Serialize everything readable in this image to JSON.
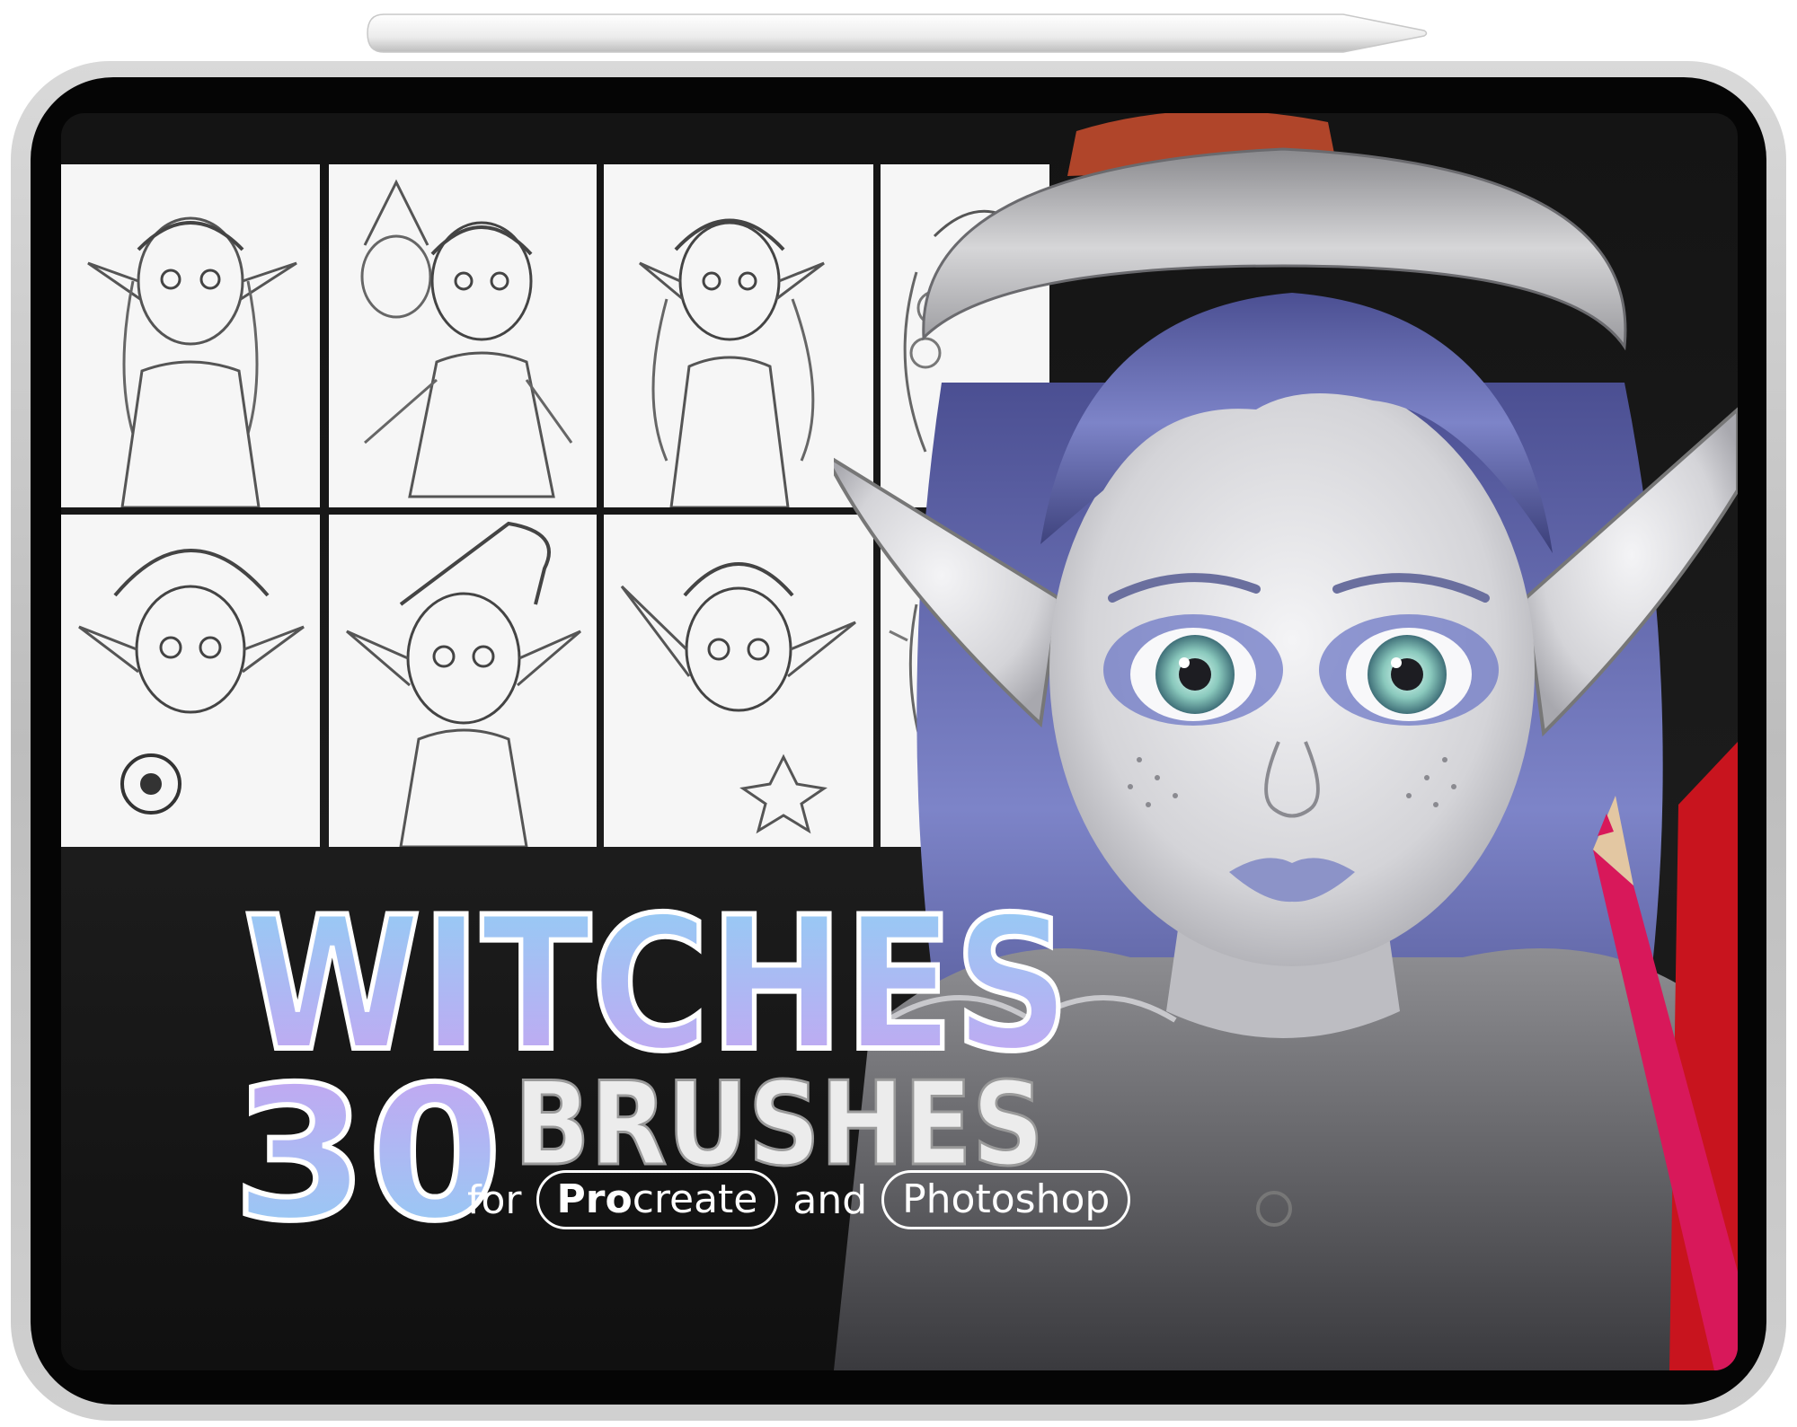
{
  "title": {
    "line1": "WITCHES",
    "number": "30",
    "line2": "BRUSHES"
  },
  "subtitle": {
    "for_text": "for",
    "app1_bold": "Pro",
    "app1_rest": "create",
    "and_text": "and",
    "app2": "Photoshop"
  },
  "colors": {
    "title_gradient_top": "#8fd0f4",
    "title_gradient_bottom": "#c9a2f2",
    "brushes_fill": "#ececec",
    "screen_bg": "#161616",
    "pencil_pink": "#d8185a",
    "pencil_red": "#c8141e"
  },
  "thumbnails_count": 8
}
